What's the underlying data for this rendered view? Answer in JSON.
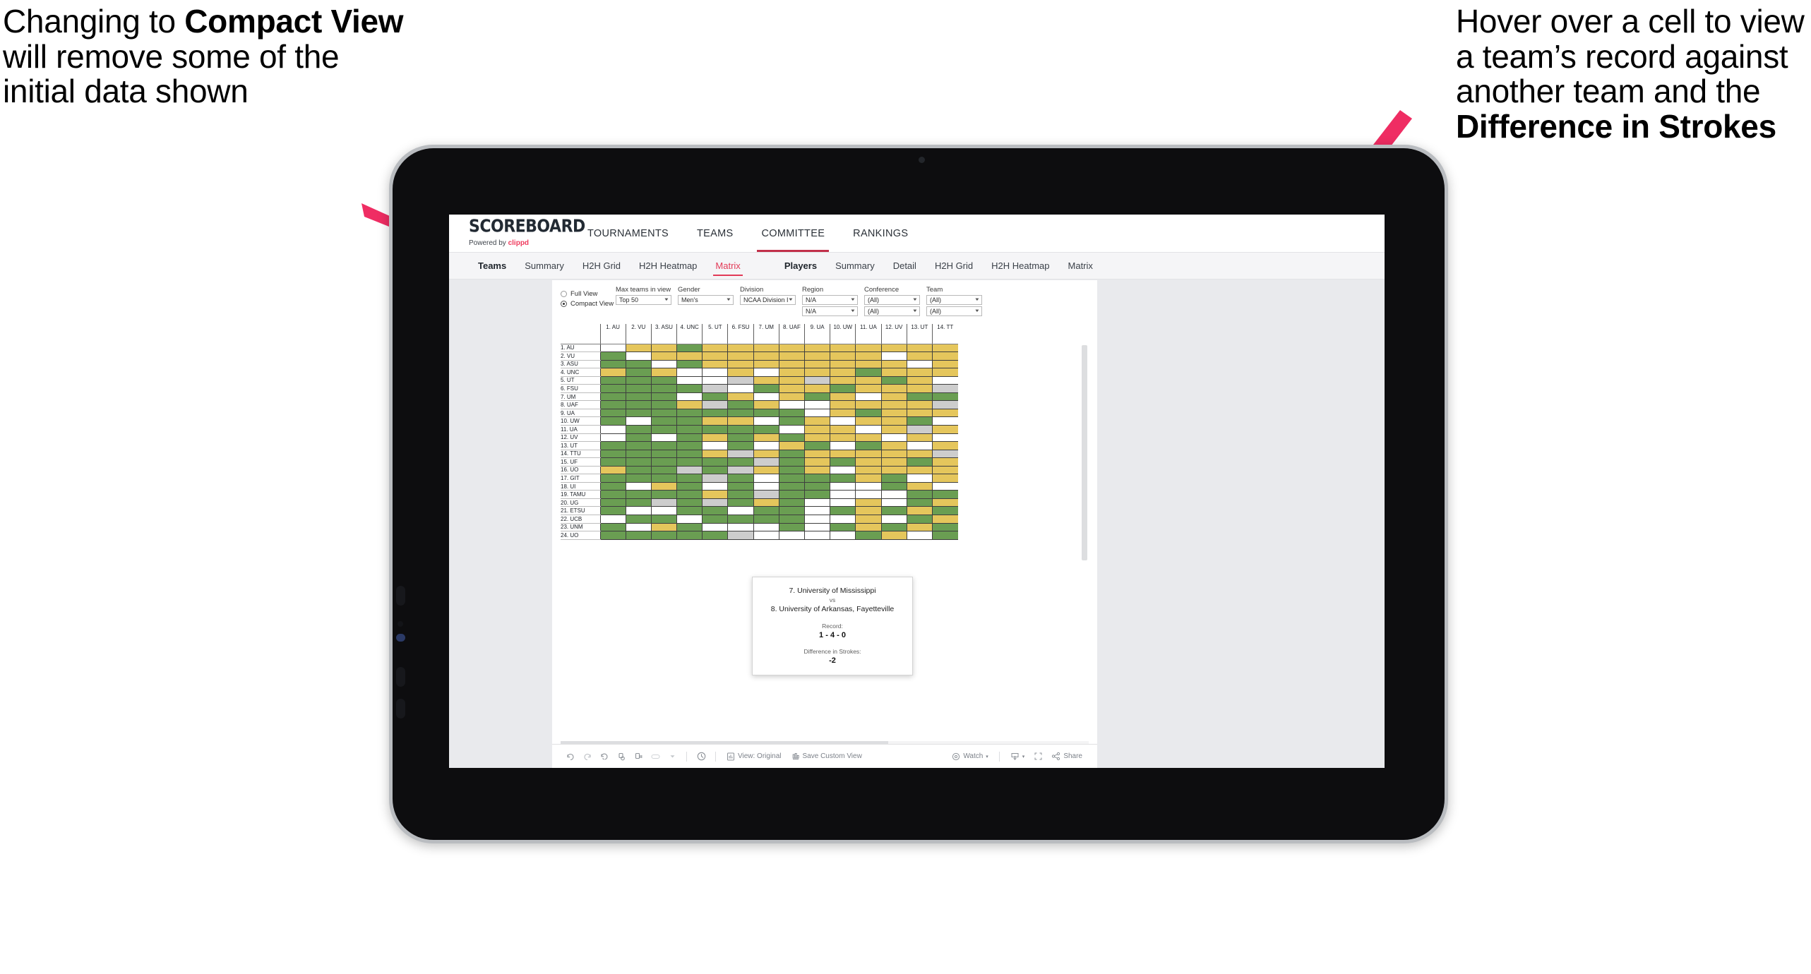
{
  "annotations": {
    "left": {
      "pre": "Changing to ",
      "bold": "Compact View",
      "post": " will remove some of the initial data shown"
    },
    "right": {
      "pre": "Hover over a cell to view a team’s record against another team and the ",
      "bold": "Difference in Strokes",
      "post": ""
    },
    "arrow_color": "#ef2d63"
  },
  "app": {
    "logo": {
      "title": "SCOREBOARD",
      "powered_prefix": "Powered by ",
      "brand": "clippd"
    },
    "topnav": [
      {
        "label": "TOURNAMENTS",
        "active": false
      },
      {
        "label": "TEAMS",
        "active": false
      },
      {
        "label": "COMMITTEE",
        "active": true
      },
      {
        "label": "RANKINGS",
        "active": false
      }
    ],
    "subnav": {
      "teams_group": [
        {
          "label": "Teams",
          "head": true
        },
        {
          "label": "Summary"
        },
        {
          "label": "H2H Grid"
        },
        {
          "label": "H2H Heatmap"
        },
        {
          "label": "Matrix",
          "selected": true
        }
      ],
      "players_group": [
        {
          "label": "Players",
          "head": true
        },
        {
          "label": "Summary"
        },
        {
          "label": "Detail"
        },
        {
          "label": "H2H Grid"
        },
        {
          "label": "H2H Heatmap"
        },
        {
          "label": "Matrix"
        }
      ]
    }
  },
  "filters": {
    "view_mode": {
      "options": [
        {
          "label": "Full View",
          "selected": false
        },
        {
          "label": "Compact View",
          "selected": true
        }
      ]
    },
    "max_teams": {
      "label": "Max teams in view",
      "value": "Top 50"
    },
    "gender": {
      "label": "Gender",
      "value": "Men's"
    },
    "division": {
      "label": "Division",
      "value": "NCAA Division I"
    },
    "region": {
      "label": "Region",
      "value1": "N/A",
      "value2": "N/A"
    },
    "conference": {
      "label": "Conference",
      "value1": "(All)",
      "value2": "(All)"
    },
    "team": {
      "label": "Team",
      "value1": "(All)",
      "value2": "(All)"
    }
  },
  "matrix": {
    "colors": {
      "win": "#6a9e52",
      "loss": "#e5c65c",
      "tie": "#cdcdcd",
      "none": "#ffffff"
    },
    "columns": [
      "1. AU",
      "2. VU",
      "3. ASU",
      "4. UNC",
      "5. UT",
      "6. FSU",
      "7. UM",
      "8. UAF",
      "9. UA",
      "10. UW",
      "11. UA",
      "12. UV",
      "13. UT",
      "14. TT"
    ],
    "rows": [
      "1. AU",
      "2. VU",
      "3. ASU",
      "4. UNC",
      "5. UT",
      "6. FSU",
      "7. UM",
      "8. UAF",
      "9. UA",
      "10. UW",
      "11. UA",
      "12. UV",
      "13. UT",
      "14. TTU",
      "15. UF",
      "16. UO",
      "17. GIT",
      "18. UI",
      "19. TAMU",
      "20. UG",
      "21. ETSU",
      "22. UCB",
      "23. UNM",
      "24. UO"
    ],
    "cells": [
      [
        "w",
        "y",
        "y",
        "g",
        "y",
        "y",
        "y",
        "y",
        "y",
        "y",
        "y",
        "y",
        "y",
        "y"
      ],
      [
        "g",
        "w",
        "y",
        "y",
        "y",
        "y",
        "y",
        "y",
        "y",
        "y",
        "y",
        "w",
        "y",
        "y"
      ],
      [
        "g",
        "g",
        "w",
        "g",
        "y",
        "y",
        "y",
        "y",
        "y",
        "y",
        "y",
        "y",
        "w",
        "y"
      ],
      [
        "y",
        "g",
        "y",
        "w",
        "w",
        "y",
        "w",
        "y",
        "y",
        "y",
        "g",
        "y",
        "y",
        "y"
      ],
      [
        "g",
        "g",
        "g",
        "w",
        "w",
        "a",
        "y",
        "y",
        "a",
        "y",
        "y",
        "g",
        "y",
        "w"
      ],
      [
        "g",
        "g",
        "g",
        "g",
        "a",
        "w",
        "g",
        "y",
        "y",
        "g",
        "y",
        "y",
        "y",
        "a"
      ],
      [
        "g",
        "g",
        "g",
        "w",
        "g",
        "y",
        "w",
        "y",
        "g",
        "y",
        "w",
        "y",
        "g",
        "g"
      ],
      [
        "g",
        "g",
        "g",
        "y",
        "a",
        "g",
        "y",
        "w",
        "w",
        "y",
        "y",
        "y",
        "y",
        "a"
      ],
      [
        "g",
        "g",
        "g",
        "g",
        "g",
        "g",
        "g",
        "g",
        "w",
        "y",
        "g",
        "y",
        "y",
        "y"
      ],
      [
        "g",
        "w",
        "g",
        "g",
        "y",
        "y",
        "w",
        "g",
        "y",
        "w",
        "y",
        "y",
        "g",
        "w"
      ],
      [
        "w",
        "g",
        "g",
        "g",
        "g",
        "g",
        "g",
        "w",
        "y",
        "y",
        "w",
        "y",
        "a",
        "y"
      ],
      [
        "w",
        "g",
        "w",
        "g",
        "y",
        "g",
        "y",
        "g",
        "y",
        "y",
        "y",
        "w",
        "y",
        "w"
      ],
      [
        "g",
        "g",
        "g",
        "g",
        "w",
        "g",
        "w",
        "y",
        "g",
        "w",
        "g",
        "y",
        "w",
        "y"
      ],
      [
        "g",
        "g",
        "g",
        "g",
        "y",
        "a",
        "y",
        "g",
        "y",
        "y",
        "y",
        "y",
        "y",
        "a"
      ],
      [
        "g",
        "g",
        "g",
        "g",
        "g",
        "g",
        "a",
        "g",
        "y",
        "g",
        "y",
        "y",
        "g",
        "y"
      ],
      [
        "y",
        "g",
        "g",
        "a",
        "g",
        "a",
        "y",
        "g",
        "y",
        "w",
        "y",
        "y",
        "y",
        "y"
      ],
      [
        "g",
        "g",
        "g",
        "g",
        "a",
        "g",
        "w",
        "g",
        "g",
        "g",
        "y",
        "g",
        "w",
        "y"
      ],
      [
        "g",
        "w",
        "y",
        "g",
        "w",
        "g",
        "w",
        "g",
        "g",
        "w",
        "w",
        "g",
        "y",
        "w"
      ],
      [
        "g",
        "g",
        "g",
        "g",
        "y",
        "g",
        "a",
        "g",
        "g",
        "w",
        "w",
        "w",
        "g",
        "g"
      ],
      [
        "g",
        "g",
        "a",
        "g",
        "a",
        "g",
        "y",
        "g",
        "w",
        "w",
        "y",
        "w",
        "g",
        "y"
      ],
      [
        "g",
        "w",
        "w",
        "g",
        "g",
        "w",
        "g",
        "g",
        "w",
        "g",
        "y",
        "g",
        "y",
        "g"
      ],
      [
        "w",
        "g",
        "g",
        "w",
        "g",
        "g",
        "g",
        "g",
        "w",
        "w",
        "y",
        "w",
        "g",
        "y"
      ],
      [
        "g",
        "w",
        "y",
        "g",
        "w",
        "w",
        "w",
        "g",
        "w",
        "g",
        "y",
        "g",
        "y",
        "g"
      ],
      [
        "g",
        "g",
        "g",
        "g",
        "g",
        "a",
        "w",
        "w",
        "w",
        "w",
        "g",
        "y",
        "w",
        "g"
      ]
    ]
  },
  "tooltip": {
    "team_a": "7. University of Mississippi",
    "vs": "vs",
    "team_b": "8. University of Arkansas, Fayetteville",
    "record_label": "Record:",
    "record_value": "1 - 4 - 0",
    "diff_label": "Difference in Strokes:",
    "diff_value": "-2"
  },
  "toolbar": {
    "icons": [
      "undo-icon",
      "redo-icon",
      "revert-icon",
      "refresh-icon",
      "pause-icon",
      "shape-icon",
      "shape-dropdown-caret"
    ],
    "history_icon": "history-clock-icon",
    "view_original": {
      "icon": "view-original-icon",
      "label": "View: Original"
    },
    "save_custom": {
      "icon": "save-custom-view-icon",
      "label": "Save Custom View"
    },
    "watch": {
      "icon": "watch-icon",
      "label": "Watch",
      "caret": "▾"
    },
    "download": {
      "icon": "download-icon",
      "caret": "▾"
    },
    "fullscreen": {
      "icon": "fullscreen-icon"
    },
    "share": {
      "icon": "share-icon",
      "label": "Share"
    }
  }
}
